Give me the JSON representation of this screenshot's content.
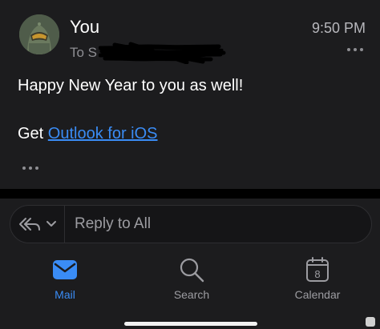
{
  "message": {
    "sender": "You",
    "recipient_prefix": "To S",
    "time": "9:50 PM",
    "greeting": "Happy New Year to you as well!",
    "signature_prefix": "Get ",
    "signature_link": "Outlook for iOS"
  },
  "reply": {
    "placeholder": "Reply to All"
  },
  "tabs": [
    {
      "label": "Mail",
      "icon": "mail-icon",
      "active": true
    },
    {
      "label": "Search",
      "icon": "search-icon",
      "active": false
    },
    {
      "label": "Calendar",
      "icon": "calendar-icon",
      "active": false,
      "badge": "8"
    }
  ],
  "colors": {
    "accent": "#3a8cf5",
    "background": "#000000",
    "surface": "#1c1c1e",
    "muted_text": "#9c9ca1"
  }
}
